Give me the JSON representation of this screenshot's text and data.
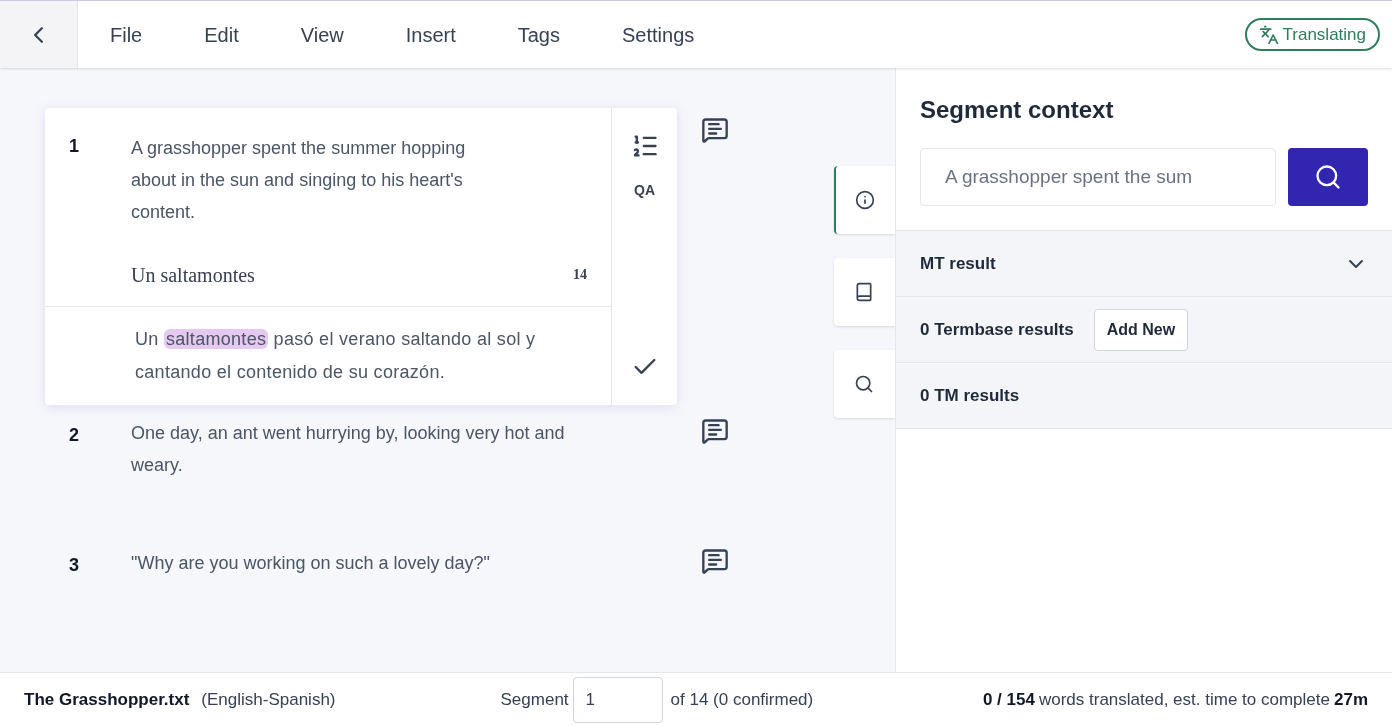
{
  "menu": [
    "File",
    "Edit",
    "View",
    "Insert",
    "Tags",
    "Settings"
  ],
  "status_badge": "Translating",
  "segments": [
    {
      "number": "1",
      "active": true,
      "source": "A grasshopper spent the summer hopping about in the sun and singing to his heart's content.",
      "suggestion": "Un saltamontes",
      "count": "14",
      "target": [
        {
          "text": "Un ",
          "highlighted": false
        },
        {
          "text": "saltamontes",
          "highlighted": true
        },
        {
          "text": " pasó el verano saltando al sol y cantando el contenido de su corazón.",
          "highlighted": false
        }
      ],
      "tool_label": "QA"
    },
    {
      "number": "2",
      "active": false,
      "source": "One day, an ant went hurrying by, looking very hot and weary."
    },
    {
      "number": "3",
      "active": false,
      "source": "\"Why are you working on such a lovely day?\""
    }
  ],
  "side_tabs": [
    {
      "kind": "info",
      "selected": true
    },
    {
      "kind": "book",
      "selected": false
    },
    {
      "kind": "search",
      "selected": false
    }
  ],
  "context": {
    "title": "Segment context",
    "search_value": "A grasshopper spent the sum",
    "sections": [
      {
        "label": "MT result",
        "expanded": false
      },
      {
        "label": "0 Termbase results",
        "button": "Add New"
      },
      {
        "label": "0 TM results"
      }
    ]
  },
  "footer": {
    "file": "The Grasshopper.txt",
    "languages": "(English-Spanish)",
    "segment_label": "Segment",
    "segment_value": "1",
    "segment_total": "of 14 (0 confirmed)",
    "progress": "0 / 154",
    "progress_text": "words translated, est. time to complete",
    "time": "27m"
  }
}
